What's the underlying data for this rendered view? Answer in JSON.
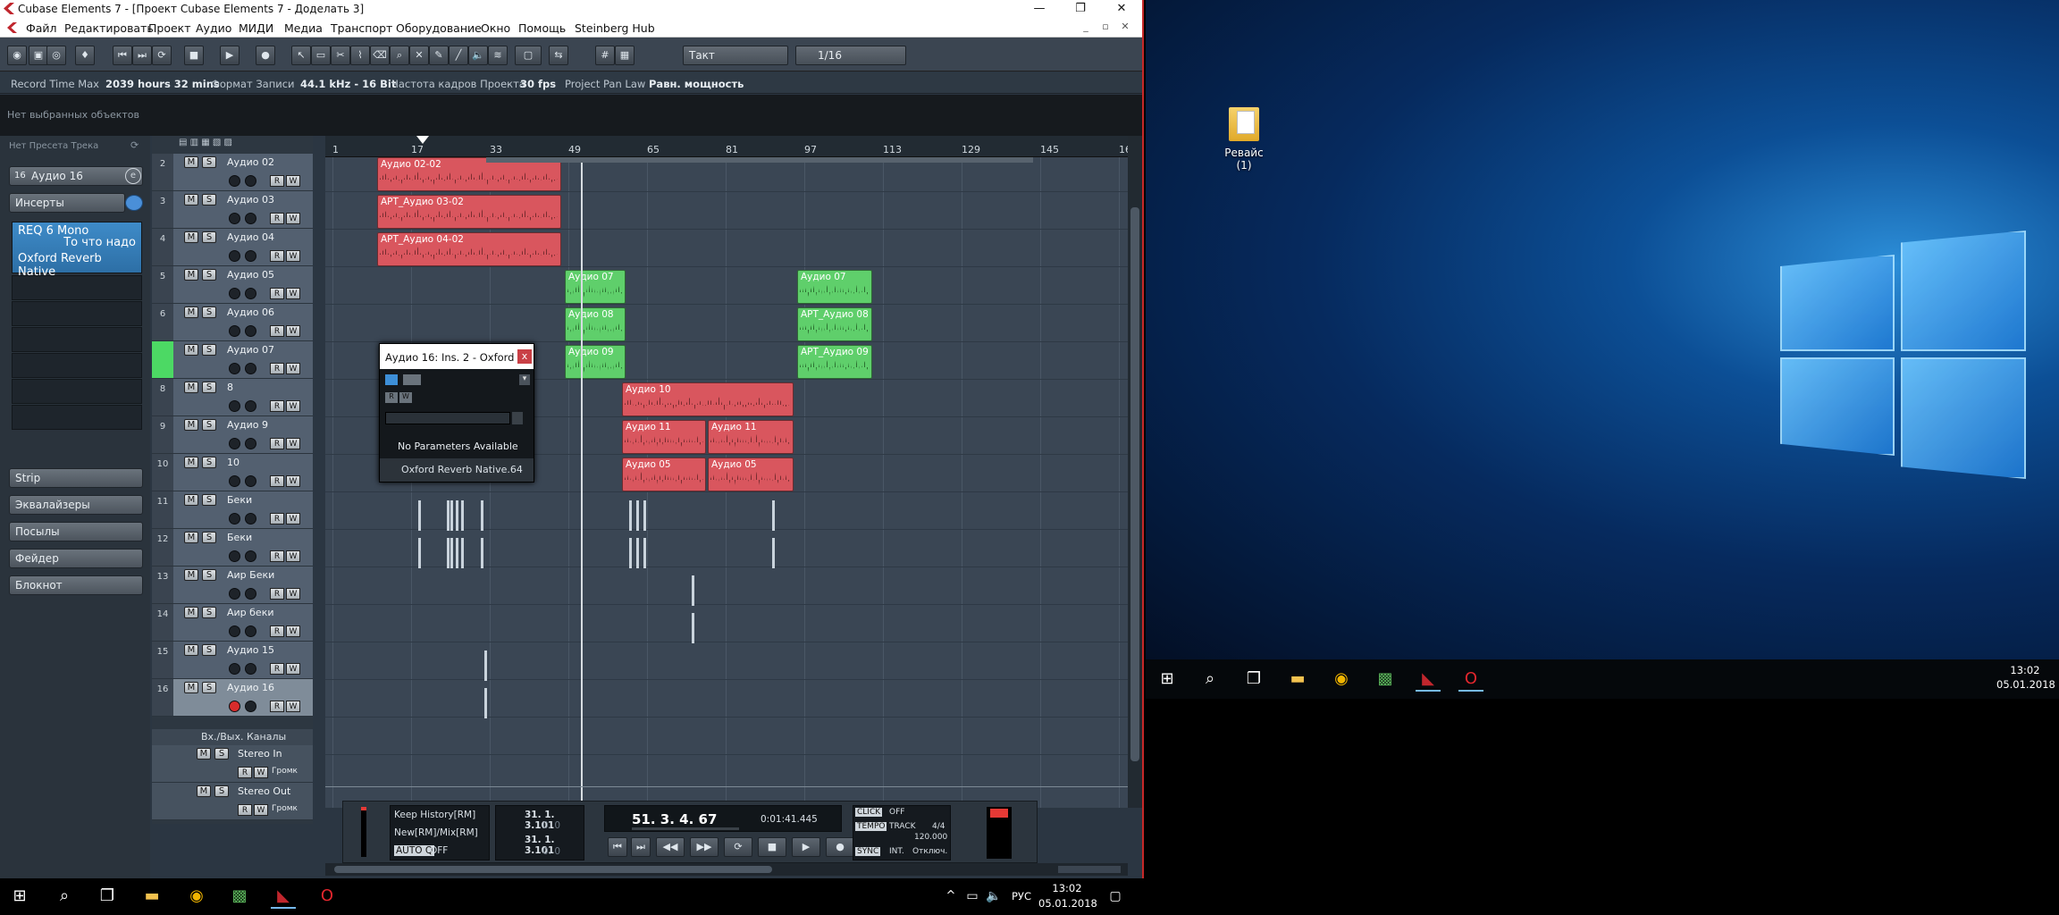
{
  "window": {
    "title": "Cubase Elements 7 - [Проект Cubase Elements 7 - Доделать 3]"
  },
  "menu": [
    "Файл",
    "Редактировать",
    "Проект",
    "Аудио",
    "МИДИ",
    "Медиа",
    "Транспорт",
    "Оборудование",
    "Окно",
    "Помощь",
    "Steinberg Hub"
  ],
  "toolbar": {
    "snap_type": "Такт",
    "quantize": "1/16"
  },
  "infoline": {
    "rec_time_label": "Record Time Max",
    "rec_time_value": "2039 hours 32 mins",
    "format_label": "Формат Записи",
    "format_value": "44.1 kHz - 16 Bit",
    "fps_label": "Частота кадров Проекта",
    "fps_value": "30 fps",
    "panlaw_label": "Project Pan Law",
    "panlaw_value": "Равн. мощность"
  },
  "no_objects": "Нет выбранных объектов",
  "inspector": {
    "preset": "Нет Пресета Трека",
    "track_num": "16",
    "track_name": "Аудио 16",
    "inserts": "Инсерты",
    "insert1_a": "REQ 6 Mono",
    "insert1_b": "То что надо",
    "insert2": "Oxford Reverb Native",
    "sections": [
      "Strip",
      "Эквалайзеры",
      "Посылы",
      "Фейдер",
      "Блокнот"
    ]
  },
  "tracks": [
    {
      "num": "2",
      "name": "Аудио 02"
    },
    {
      "num": "3",
      "name": "Аудио 03"
    },
    {
      "num": "4",
      "name": "Аудио 04"
    },
    {
      "num": "5",
      "name": "Аудио 05"
    },
    {
      "num": "6",
      "name": "Аудио 06"
    },
    {
      "num": "7",
      "name": "Аудио 07"
    },
    {
      "num": "8",
      "name": "8"
    },
    {
      "num": "9",
      "name": "Аудио 9"
    },
    {
      "num": "10",
      "name": "10"
    },
    {
      "num": "11",
      "name": "Беки"
    },
    {
      "num": "12",
      "name": "Беки"
    },
    {
      "num": "13",
      "name": "Аир Беки"
    },
    {
      "num": "14",
      "name": "Аир беки"
    },
    {
      "num": "15",
      "name": "Аудио 15"
    },
    {
      "num": "16",
      "name": "Аудио 16"
    }
  ],
  "io": {
    "folder": "Вх./Вых. Каналы",
    "stereo_in": "Stereo In",
    "stereo_out": "Stereo Out",
    "vol": "Громк"
  },
  "ruler": [
    "1",
    "17",
    "33",
    "49",
    "65",
    "81",
    "97",
    "113",
    "129",
    "145",
    "16"
  ],
  "clips": [
    {
      "label": "Аудио 02-02",
      "color": "red"
    },
    {
      "label": "АРТ_Аудио 03-02",
      "color": "red"
    },
    {
      "label": "АРТ_Аудио 04-02",
      "color": "red"
    },
    {
      "label": "Аудио 07",
      "color": "green"
    },
    {
      "label": "Аудио 08",
      "color": "green"
    },
    {
      "label": "Аудио 09",
      "color": "green"
    },
    {
      "label": "Аудио 07",
      "color": "green"
    },
    {
      "label": "АРТ_Аудио 08",
      "color": "green"
    },
    {
      "label": "АРТ_Аудио 09",
      "color": "green"
    },
    {
      "label": "Аудио 10",
      "color": "red"
    },
    {
      "label": "Аудио 11",
      "color": "red"
    },
    {
      "label": "Аудио 11",
      "color": "red"
    },
    {
      "label": "Аудио 05",
      "color": "red"
    },
    {
      "label": "Аудио 05",
      "color": "red"
    }
  ],
  "plugin": {
    "title": "Аудио 16: Ins. 2 - Oxford ...",
    "close": "x",
    "no_params": "No Parameters Available",
    "name": "Oxford Reverb Native.64"
  },
  "transport": {
    "history1": "Keep History[RM]",
    "history2": "New[RM]/Mix[RM]",
    "autoq": "AUTO Q",
    "autoq_val": "OFF",
    "loc1": "31. 1. 3.101",
    "loc2": "31. 1. 3.101",
    "zero": "0. 0",
    "pos": "51. 3. 4. 67",
    "time": "0:01:41.445",
    "click": "CLICK",
    "click_val": "OFF",
    "tempo": "TEMPO",
    "track": "TRACK",
    "sig": "4/4",
    "bpm": "120.000",
    "sync": "SYNC",
    "int": "INT.",
    "off": "Отключ."
  },
  "desktop": {
    "icon_label": "Ревайс (1)",
    "clock_time": "13:02",
    "clock_date": "05.01.2018"
  },
  "taskbar1": {
    "lang": "РУС",
    "time": "13:02",
    "date": "05.01.2018"
  }
}
